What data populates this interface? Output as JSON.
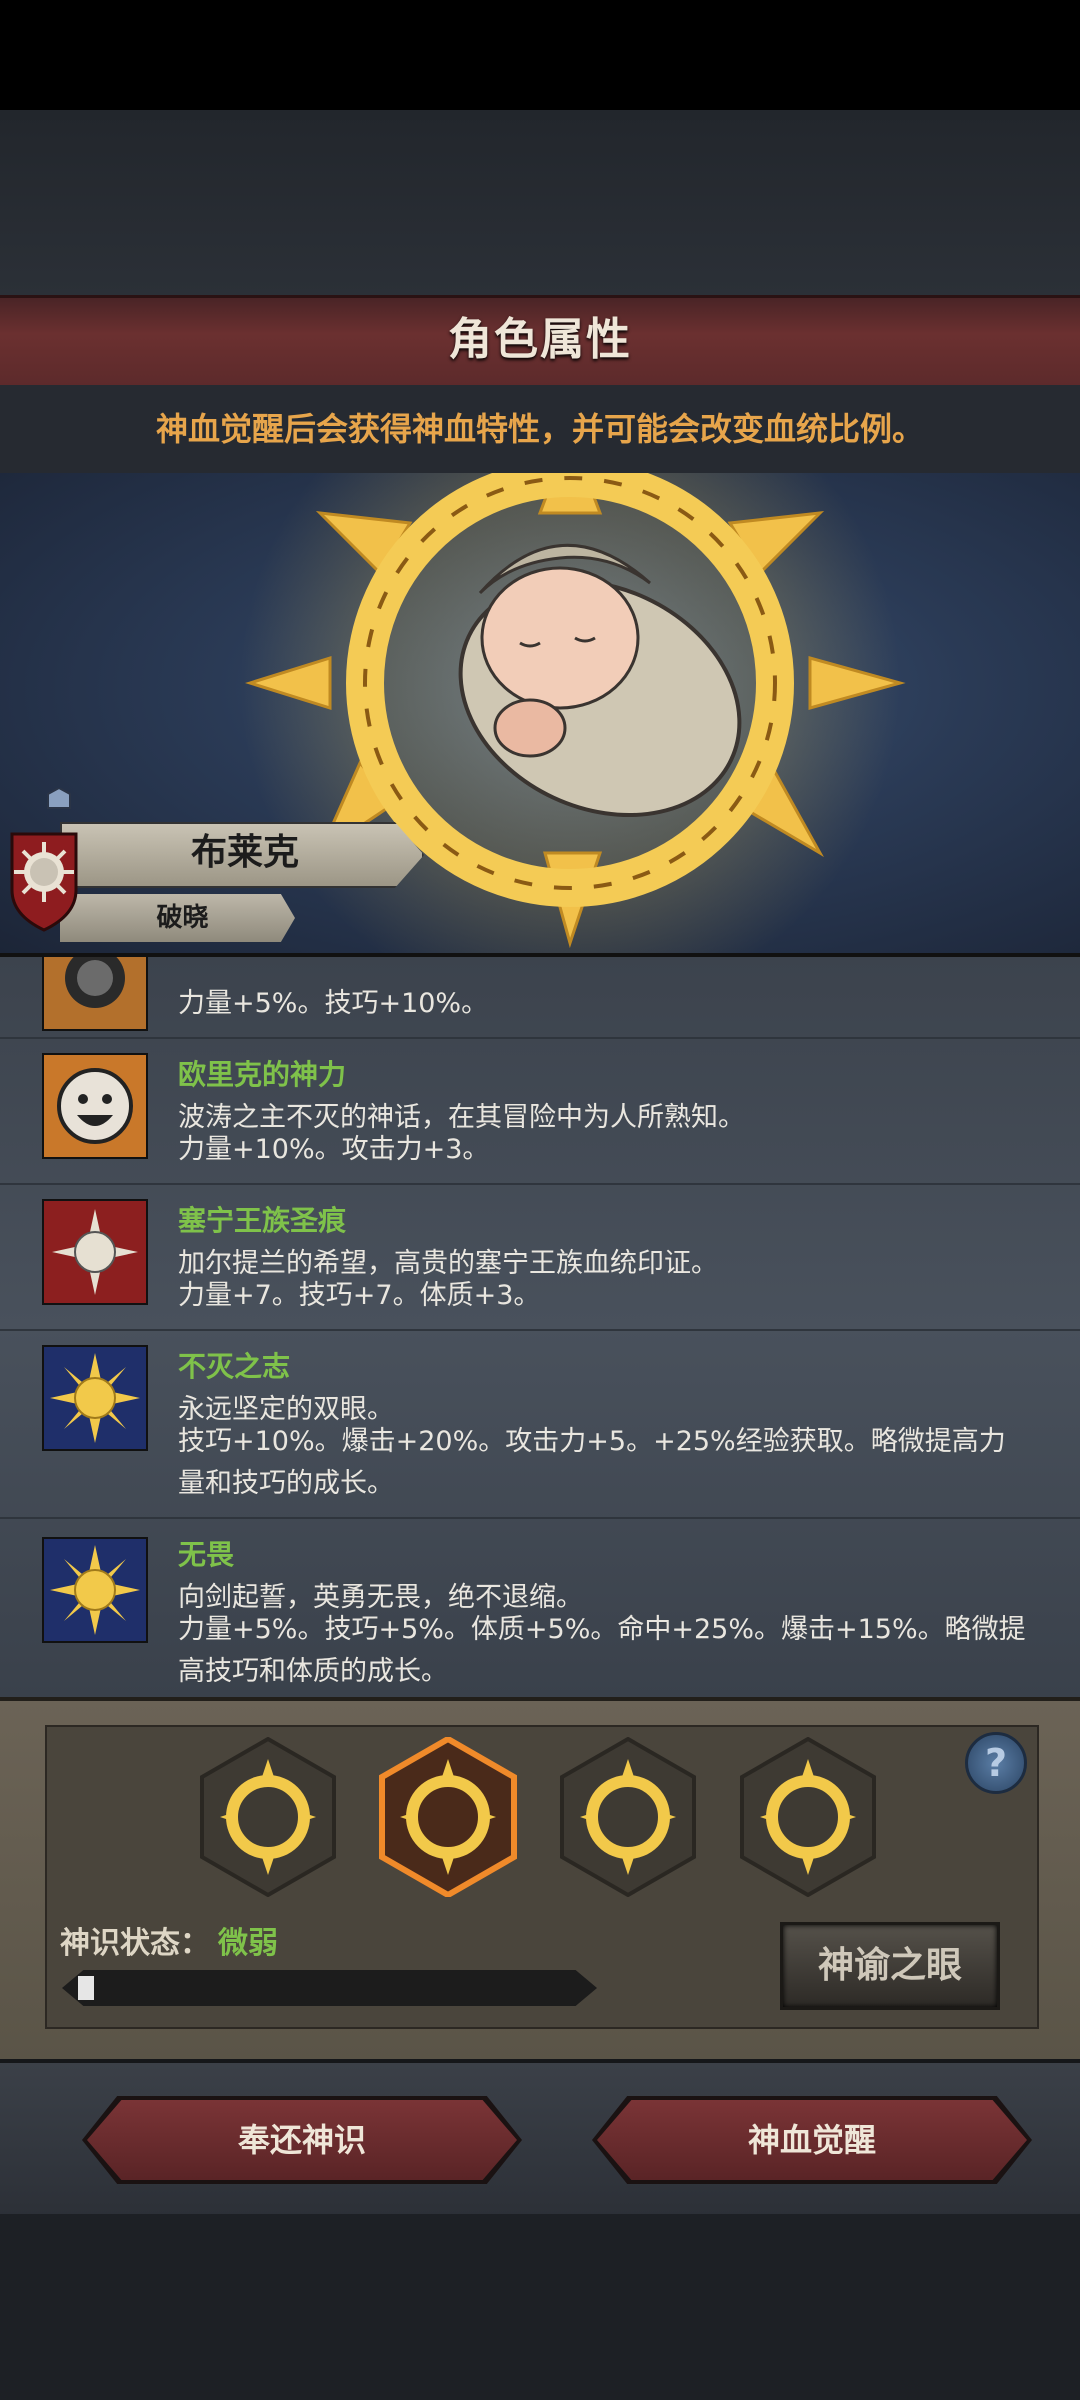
{
  "header": {
    "title": "角色属性",
    "subtitle": "神血觉醒后会获得神血特性，并可能会改变血统比例。"
  },
  "character": {
    "name": "布莱克",
    "title": "破晓"
  },
  "traits": [
    {
      "name": "",
      "description": "",
      "effect": "力量+5%。技巧+10%。",
      "icon": "dark-sun-icon"
    },
    {
      "name": "欧里克的神力",
      "description": "波涛之主不灭的神话，在其冒险中为人所熟知。",
      "effect": "力量+10%。攻击力+3。",
      "icon": "smiling-face-icon"
    },
    {
      "name": "塞宁王族圣痕",
      "description": "加尔提兰的希望，高贵的塞宁王族血统印证。",
      "effect": "力量+7。技巧+7。体质+3。",
      "icon": "white-sun-icon"
    },
    {
      "name": "不灭之志",
      "description": "永远坚定的双眼。",
      "effect": "技巧+10%。爆击+20%。攻击力+5。+25%经验获取。略微提高力量和技巧的成长。",
      "icon": "golden-sun-icon"
    },
    {
      "name": "无畏",
      "description": "向剑起誓，英勇无畏，绝不退缩。",
      "effect": "力量+5%。技巧+5%。体质+5%。命中+25%。爆击+15%。略微提高技巧和体质的成长。",
      "icon": "golden-sun-icon"
    }
  ],
  "divine_slots": [
    {
      "icon": "sun-ring-icon",
      "selected": false
    },
    {
      "icon": "sun-ring-icon",
      "selected": true
    },
    {
      "icon": "sun-ring-icon",
      "selected": false
    },
    {
      "icon": "sun-ring-icon",
      "selected": false
    }
  ],
  "status": {
    "label": "神识状态：",
    "value": "微弱",
    "progress": 0.02
  },
  "buttons": {
    "help": "?",
    "oracle_eye": "神谕之眼",
    "return_divinity": "奉还神识",
    "divine_awaken": "神血觉醒"
  },
  "colors": {
    "accent_green": "#7fc24a",
    "subtitle_orange": "#e7a54b",
    "banner_red": "#6b3030"
  }
}
